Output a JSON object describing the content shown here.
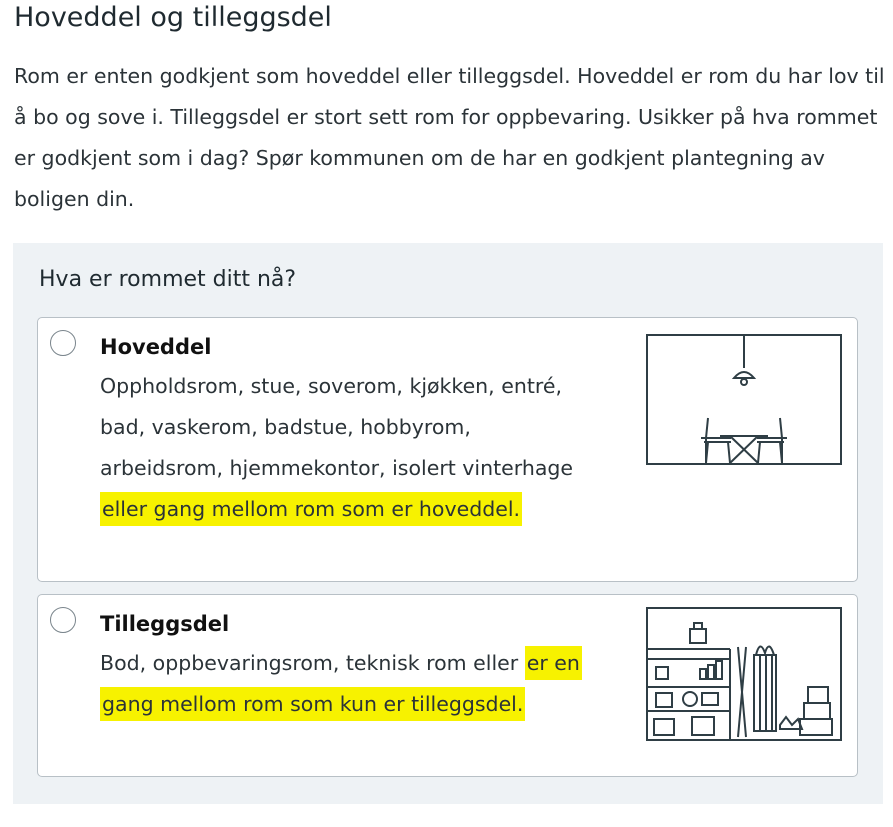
{
  "section": {
    "heading": "Hoveddel og tilleggsdel",
    "intro": "Rom er enten godkjent som hoveddel eller tilleggsdel. Hoveddel er rom du har lov til å bo og sove i. Tilleggsdel er stort sett rom for oppbevaring. Usikker på hva rommet er godkjent som i dag? Spør kommunen om de har en godkjent plantegning av boligen din."
  },
  "question": {
    "label": "Hva er rommet ditt nå?",
    "options": [
      {
        "title": "Hoveddel",
        "desc_plain": "Oppholdsrom, stue, soverom, kjøkken, entré, bad, vaskerom, badstue, hobbyrom, arbeidsrom, hjemmekontor, isolert vinterhage ",
        "desc_highlight": "eller gang mellom rom som er hoveddel.",
        "icon": "dining-room-illustration-icon",
        "selected": false
      },
      {
        "title": "Tilleggsdel",
        "desc_plain": "Bod, oppbevaringsrom, teknisk rom eller ",
        "desc_highlight": "er en gang mellom rom som kun er tilleggsdel.",
        "icon": "storage-room-illustration-icon",
        "selected": false
      }
    ]
  },
  "colors": {
    "panel_bg": "#eef2f5",
    "highlight": "#f7f200",
    "illustration_stroke": "#2f3e45"
  }
}
